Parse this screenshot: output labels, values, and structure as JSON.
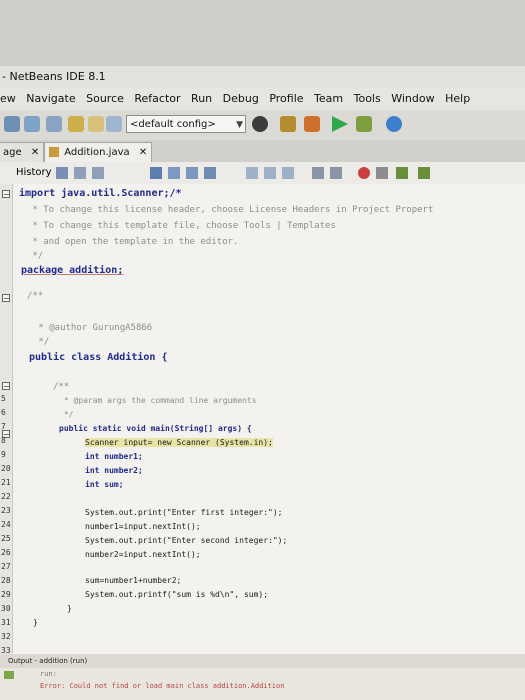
{
  "window": {
    "title": "- NetBeans IDE 8.1"
  },
  "menu": [
    "ew",
    "Navigate",
    "Source",
    "Refactor",
    "Run",
    "Debug",
    "Profile",
    "Team",
    "Tools",
    "Window",
    "Help"
  ],
  "toolbar": {
    "config": "<default config>"
  },
  "tabs": [
    {
      "label": "age"
    },
    {
      "label": "Addition.java"
    }
  ],
  "editor_toolbar": {
    "history_label": "History"
  },
  "code": [
    {
      "text": "import java.util.Scanner;/*"
    },
    {
      "text": " * To change this license header, choose License Headers in Project Propert"
    },
    {
      "text": " * To change this template file, choose Tools | Templates"
    },
    {
      "text": " * and open the template in the editor."
    },
    {
      "text": " */"
    },
    {
      "text": "package addition;"
    },
    {
      "text": "/**"
    },
    {
      "text": " * @author GurungA5866"
    },
    {
      "text": " */"
    },
    {
      "text": "public class Addition {"
    },
    {
      "text": "/**"
    },
    {
      "text": " * @param args the command line arguments"
    },
    {
      "text": " */"
    },
    {
      "text": "public static void main(String[] args) {"
    },
    {
      "text": "Scanner input= new Scanner (System.in);"
    },
    {
      "text": "int number1;"
    },
    {
      "text": "int number2;"
    },
    {
      "text": "int sum;"
    },
    {
      "text": "System.out.print(\"Enter first integer:\");"
    },
    {
      "text": "number1=input.nextInt();"
    },
    {
      "text": "System.out.print(\"Enter second integer:\");"
    },
    {
      "text": "number2=input.nextInt();"
    },
    {
      "text": "sum=number1+number2;"
    },
    {
      "text": "System.out.printf(\"sum is %d\\n\", sum);"
    },
    {
      "text": "}"
    },
    {
      "text": "}"
    }
  ],
  "line_numbers": [
    "5",
    "6",
    "7",
    "8",
    "9",
    "20",
    "21",
    "22",
    "23",
    "24",
    "25",
    "26",
    "27",
    "28",
    "29",
    "30",
    "31",
    "32",
    "33"
  ],
  "output": {
    "title": "Output - addition (run)",
    "run_label": "run:",
    "error": "Error: Could not find or load main class addition.Addition"
  }
}
